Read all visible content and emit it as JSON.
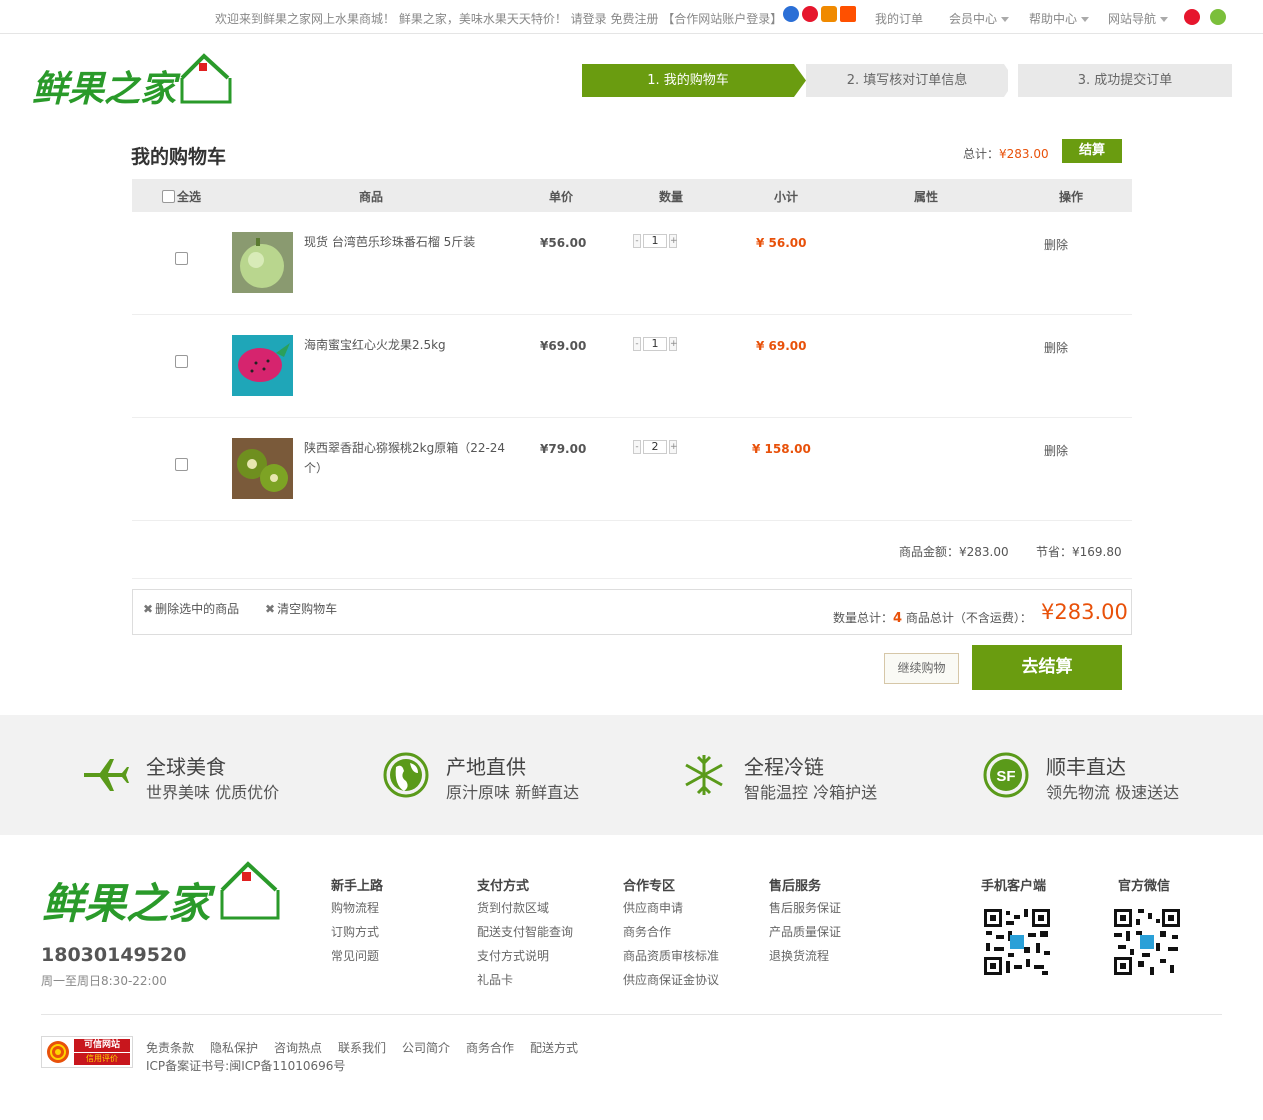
{
  "topbar": {
    "welcome": "欢迎来到鲜果之家网上水果商城！ 鲜果之家，美味水果天天特价！ 请登录 免费注册 【合作网站账户登录】",
    "my_orders": "我的订单",
    "member_center": "会员中心",
    "help_center": "帮助中心",
    "site_nav": "网站导航"
  },
  "logo": {
    "text": "鲜果之家"
  },
  "steps": [
    {
      "label": "1. 我的购物车",
      "active": true
    },
    {
      "label": "2. 填写核对订单信息",
      "active": false
    },
    {
      "label": "3. 成功提交订单",
      "active": false
    }
  ],
  "cart": {
    "title": "我的购物车",
    "total_label": "总计：",
    "total_value": "¥283.00",
    "checkout_small": "结算",
    "headers": {
      "select_all": "全选",
      "product": "商品",
      "unit_price": "单价",
      "quantity": "数量",
      "subtotal": "小计",
      "attr": "属性",
      "action": "操作"
    },
    "items": [
      {
        "name": "现货 台湾芭乐珍珠番石榴 5斤装",
        "price": "¥56.00",
        "qty": "1",
        "subtotal": "¥ 56.00",
        "action": "删除"
      },
      {
        "name": "海南蜜宝红心火龙果2.5kg",
        "price": "¥69.00",
        "qty": "1",
        "subtotal": "¥ 69.00",
        "action": "删除"
      },
      {
        "name": "陕西翠香甜心猕猴桃2kg原箱（22-24个）",
        "price": "¥79.00",
        "qty": "2",
        "subtotal": "¥ 158.00",
        "action": "删除"
      }
    ],
    "goods_amount": "商品金额：¥283.00",
    "saved": "节省：¥169.80",
    "delete_selected": "删除选中的商品",
    "clear_cart": "清空购物车",
    "qty_total_label": "数量总计：",
    "qty_total": "4",
    "goods_total_label": "商品总计（不含运费）：",
    "grand_total": "¥283.00",
    "continue": "继续购物",
    "go_checkout": "去结算"
  },
  "features": [
    {
      "icon": "airplane-icon",
      "title": "全球美食",
      "desc": "世界美味 优质优价"
    },
    {
      "icon": "globe-icon",
      "title": "产地直供",
      "desc": "原汁原味 新鲜直达"
    },
    {
      "icon": "snowflake-icon",
      "title": "全程冷链",
      "desc": "智能温控 冷箱护送"
    },
    {
      "icon": "sf-express-icon",
      "title": "顺丰直达",
      "desc": "领先物流 极速送达"
    }
  ],
  "footer": {
    "phone": "18030149520",
    "hours": "周一至周日8:30-22:00",
    "cols": [
      {
        "title": "新手上路",
        "links": [
          "购物流程",
          "订购方式",
          "常见问题"
        ]
      },
      {
        "title": "支付方式",
        "links": [
          "货到付款区域",
          "配送支付智能查询",
          "支付方式说明",
          "礼品卡"
        ]
      },
      {
        "title": "合作专区",
        "links": [
          "供应商申请",
          "商务合作",
          "商品资质审核标准",
          "供应商保证金协议"
        ]
      },
      {
        "title": "售后服务",
        "links": [
          "售后服务保证",
          "产品质量保证",
          "退换货流程"
        ]
      }
    ],
    "app_label": "手机客户端",
    "wechat_label": "官方微信",
    "bottom_links": [
      "免责条款",
      "隐私保护",
      "咨询热点",
      "联系我们",
      "公司简介",
      "商务合作",
      "配送方式"
    ],
    "icp": "ICP备案证书号:闽ICP备11010696号",
    "badge_line1": "可信网站",
    "badge_line2": "信用评价"
  }
}
